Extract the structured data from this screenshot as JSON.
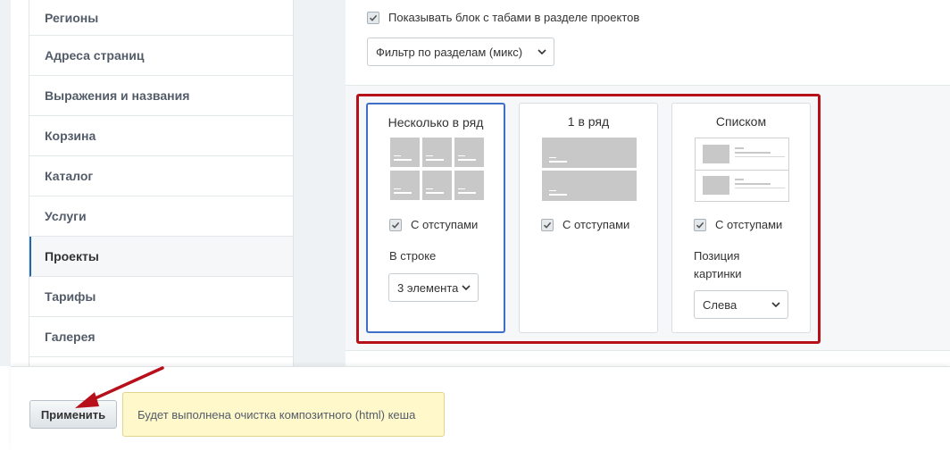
{
  "sidebar": {
    "items": [
      {
        "label": "Регионы"
      },
      {
        "label": "Адреса страниц"
      },
      {
        "label": "Выражения и названия"
      },
      {
        "label": "Корзина"
      },
      {
        "label": "Каталог"
      },
      {
        "label": "Услуги"
      },
      {
        "label": "Проекты",
        "active": true
      },
      {
        "label": "Тарифы"
      },
      {
        "label": "Галерея"
      }
    ]
  },
  "settings": {
    "show_tabs_checkbox_label": "Показывать блок с табами в разделе проектов",
    "show_tabs_checked": true,
    "filter_select_value": "Фильтр по разделам (микс)"
  },
  "layouts": {
    "grid": {
      "title": "Несколько в ряд",
      "selected": true,
      "indent_label": "С отступами",
      "indent_checked": true,
      "per_row_label": "В строке",
      "per_row_value": "3 элемента"
    },
    "single": {
      "title": "1 в ряд",
      "indent_label": "С отступами",
      "indent_checked": true
    },
    "list": {
      "title": "Списком",
      "indent_label": "С отступами",
      "indent_checked": true,
      "image_pos_label_line1": "Позиция",
      "image_pos_label_line2": "картинки",
      "image_pos_value": "Слева"
    }
  },
  "footer": {
    "apply_label": "Применить",
    "notice_text": "Будет выполнена очистка композитного (html) кеша"
  },
  "colors": {
    "highlight_frame": "#b8101b",
    "annotation_arrow": "#b8101b",
    "selected_card_border": "#3e6fc4",
    "notice_bg": "#fff8cb"
  }
}
